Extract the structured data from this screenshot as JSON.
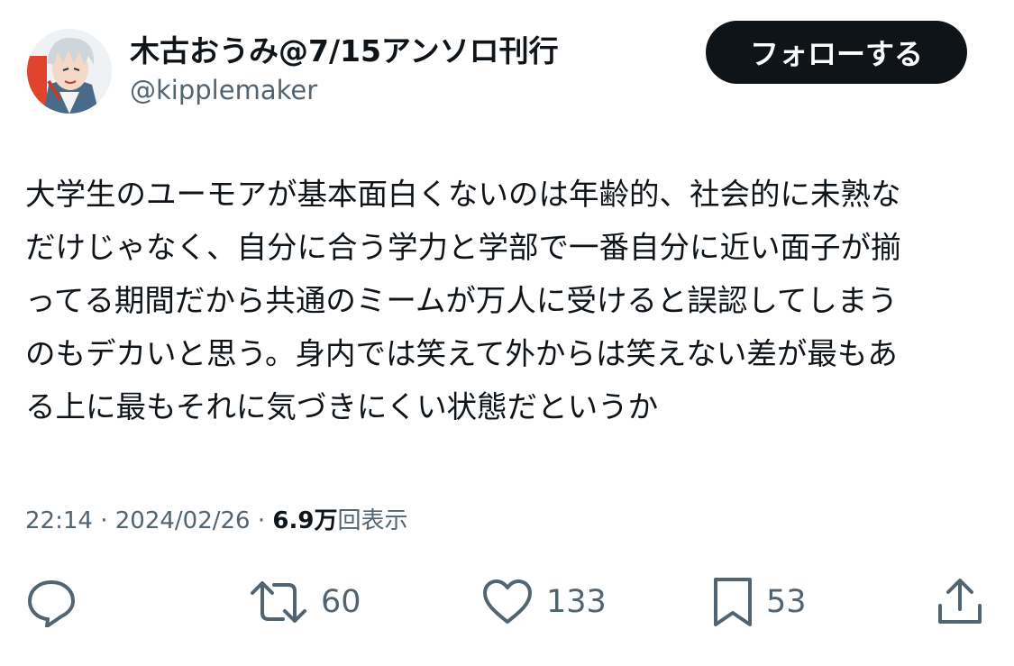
{
  "user": {
    "display_name": "木古おうみ@7/15アンソロ刊行",
    "handle": "@kipplemaker",
    "follow_label": "フォローする"
  },
  "tweet": {
    "lines": [
      "大学生のユーモアが基本面白くないのは年齢的、社会的に未熟な",
      "だけじゃなく、自分に合う学力と学部で一番自分に近い面子が揃",
      "ってる期間だから共通のミームが万人に受けると誤認してしまう",
      "のもデカいと思う。身内では笑えて外からは笑えない差が最もあ",
      "る上に最もそれに気づきにくい状態だというか"
    ],
    "time": "22:14",
    "separator": "·",
    "date": "2024/02/26",
    "views_count": "6.9万",
    "views_label": "回表示"
  },
  "actions": {
    "reply": {
      "icon": "reply-icon"
    },
    "retweet": {
      "icon": "retweet-icon",
      "count": "60"
    },
    "like": {
      "icon": "heart-icon",
      "count": "133"
    },
    "bookmark": {
      "icon": "bookmark-icon",
      "count": "53"
    },
    "share": {
      "icon": "share-icon"
    }
  },
  "colors": {
    "text_primary": "#0f1419",
    "text_secondary": "#536471",
    "button_bg": "#0f1419",
    "avatar_accent": "#e0442c"
  }
}
